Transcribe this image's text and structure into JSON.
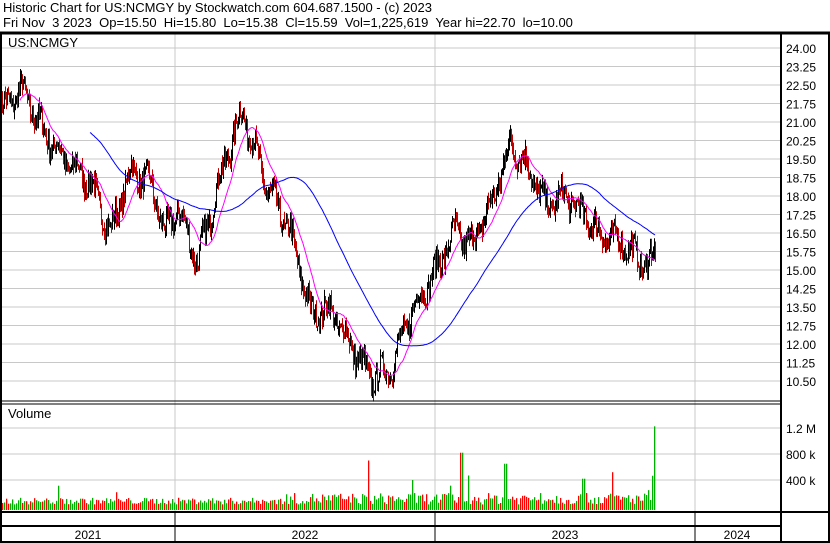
{
  "header": {
    "title": "Historic Chart for US:NCMGY by Stockwatch.com 604.687.1500 - (c) 2023",
    "quote": "Fri Nov  3 2023  Op=15.50  Hi=15.80  Lo=15.38  Cl=15.59  Vol=1,225,619  Year hi=22.70  lo=10.00"
  },
  "chart_data": [
    {
      "type": "line",
      "title": "US:NCMGY",
      "subtype": "ohlc with moving averages",
      "ylim": [
        10.0,
        24.3
      ],
      "y_ticks": [
        "24.00",
        "23.25",
        "22.50",
        "21.75",
        "21.00",
        "20.25",
        "19.50",
        "18.75",
        "18.00",
        "17.25",
        "16.50",
        "15.75",
        "15.00",
        "14.25",
        "13.50",
        "12.75",
        "12.00",
        "11.25",
        "10.50"
      ],
      "x_ticks": [
        "2021",
        "2022",
        "2023",
        "2024"
      ],
      "series": [
        {
          "name": "price",
          "color": "#000000",
          "x": [
            "2021-04",
            "2021-05",
            "2021-06",
            "2021-07",
            "2021-08",
            "2021-09",
            "2021-10",
            "2021-11",
            "2021-12",
            "2022-01",
            "2022-02",
            "2022-03",
            "2022-04",
            "2022-05",
            "2022-06",
            "2022-07",
            "2022-08",
            "2022-09",
            "2022-10",
            "2022-11",
            "2022-12",
            "2023-01",
            "2023-02",
            "2023-03",
            "2023-04",
            "2023-05",
            "2023-06",
            "2023-07",
            "2023-08",
            "2023-09",
            "2023-10",
            "2023-10",
            "2023-11",
            "2023-11"
          ],
          "values": [
            21.5,
            22.3,
            20.5,
            19.3,
            18.6,
            16.5,
            19.0,
            18.5,
            16.5,
            17.5,
            15.3,
            18.5,
            21.5,
            18.5,
            16.5,
            13.3,
            13.4,
            12.0,
            10.6,
            11.0,
            13.2,
            15.0,
            16.6,
            16.0,
            17.6,
            20.1,
            19.0,
            17.6,
            18.0,
            17.4,
            16.4,
            16.2,
            15.2,
            15.59
          ]
        },
        {
          "name": "short moving average",
          "color": "#ff00ff"
        },
        {
          "name": "long moving average",
          "color": "#0000ff"
        }
      ]
    },
    {
      "type": "bar",
      "title": "Volume",
      "y_ticks": [
        "1.2 M",
        "800 k",
        "400 k"
      ],
      "ylim": [
        0,
        1300000
      ],
      "colors": {
        "up": "#00b000",
        "down": "#ff0000"
      },
      "base_volume": 80000,
      "spikes": [
        {
          "x": "2022-10",
          "value": 700000
        },
        {
          "x": "2022-12",
          "value": 400000
        },
        {
          "x": "2023-02",
          "value": 820000
        },
        {
          "x": "2023-05",
          "value": 650000
        },
        {
          "x": "2023-09",
          "value": 420000
        },
        {
          "x": "2023-10",
          "value": 520000
        },
        {
          "x": "2023-11",
          "value": 1225619
        }
      ]
    }
  ]
}
